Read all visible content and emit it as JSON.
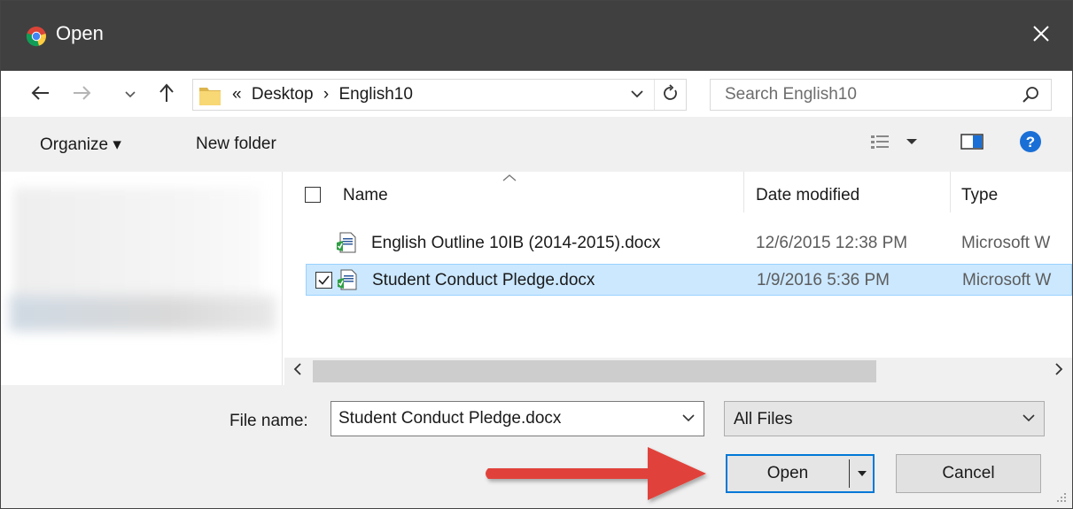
{
  "window": {
    "title": "Open",
    "app_icon": "chrome-icon",
    "close_icon": "close-icon"
  },
  "navigation": {
    "back_icon": "back-arrow-icon",
    "forward_icon": "forward-arrow-icon",
    "recent_icon": "chevron-down-icon",
    "up_icon": "up-arrow-icon",
    "address": {
      "overflow": "«",
      "crumbs": [
        "Desktop",
        "English10"
      ],
      "separator": "›"
    },
    "search_placeholder": "Search English10"
  },
  "toolbar": {
    "organize_label": "Organize ▾",
    "new_folder_label": "New folder",
    "view_icon": "view-options-icon",
    "preview_icon": "preview-pane-icon",
    "help_icon": "help-icon"
  },
  "file_list": {
    "columns": [
      "Name",
      "Date modified",
      "Type"
    ],
    "rows": [
      {
        "name": "English Outline 10IB (2014-2015).docx",
        "date": "12/6/2015 12:38 PM",
        "type": "Microsoft W",
        "selected": false
      },
      {
        "name": "Student Conduct Pledge.docx",
        "date": "1/9/2016 5:36 PM",
        "type": "Microsoft W",
        "selected": true
      }
    ]
  },
  "bottom": {
    "file_name_label": "File name:",
    "file_name_value": "Student Conduct Pledge.docx",
    "file_type": "All Files",
    "open_label": "Open",
    "cancel_label": "Cancel"
  },
  "colors": {
    "titlebar": "#404040",
    "selection": "#cce8ff",
    "accent_border": "#0078d7",
    "annotation_arrow": "#e0423a",
    "help_blue": "#1a6fd6"
  }
}
